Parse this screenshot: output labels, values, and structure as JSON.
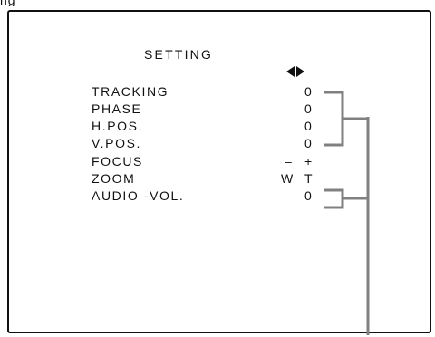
{
  "corner_label": "ng",
  "menu": {
    "title": "SETTING",
    "adjust_icon": "left-right-arrows-icon",
    "rows": [
      {
        "label": "TRACKING",
        "value": "0"
      },
      {
        "label": "PHASE",
        "value": "0"
      },
      {
        "label": "H.POS.",
        "value": "0"
      },
      {
        "label": "V.POS.",
        "value": "0"
      },
      {
        "label": "FOCUS",
        "left": "–",
        "right": "+"
      },
      {
        "label": "ZOOM",
        "left": "W",
        "right": "T"
      },
      {
        "label": "AUDIO -VOL.",
        "value": "0"
      }
    ]
  },
  "colors": {
    "connector": "#808080",
    "text": "#111111"
  }
}
